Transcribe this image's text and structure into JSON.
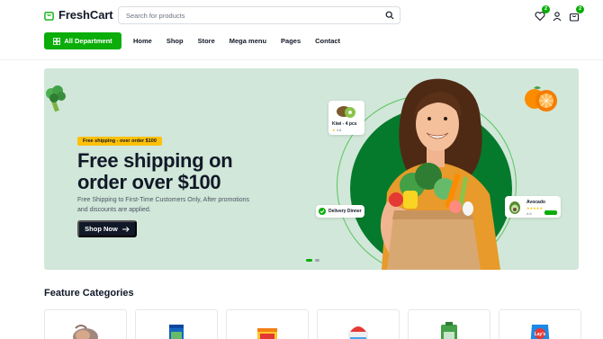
{
  "brand": {
    "name": "FreshCart",
    "accent": "#0aad0a"
  },
  "search": {
    "placeholder": "Search for products"
  },
  "header_icons": [
    {
      "name": "heart-icon",
      "badge": "2"
    },
    {
      "name": "user-icon",
      "badge": ""
    },
    {
      "name": "bag-icon",
      "badge": "2"
    }
  ],
  "nav": {
    "department_button": "All Department",
    "items": [
      "Home",
      "Shop",
      "Store",
      "Mega menu",
      "Pages",
      "Contact"
    ]
  },
  "hero": {
    "badge": "Free shipping - over order $100",
    "title": "Free shipping on order over $100",
    "subtitle": "Free Shipping to First-Time Customers Only, After promotions and discounts are applied.",
    "cta": "Shop Now",
    "kiwi_card": {
      "title": "Kiwi - 4 pcs",
      "rating": "4.8"
    },
    "delivery_card": {
      "title": "Delivery Dinner"
    },
    "avocado_card": {
      "title": "Avocado",
      "rating": "4.6"
    },
    "carousel": {
      "total": 2,
      "active": 1
    }
  },
  "categories": {
    "title": "Feature Categories",
    "items": [
      "chicken-meat",
      "snack-bag",
      "bakery-pack",
      "cake-box",
      "vegetable-pack",
      "chips-bag"
    ]
  }
}
